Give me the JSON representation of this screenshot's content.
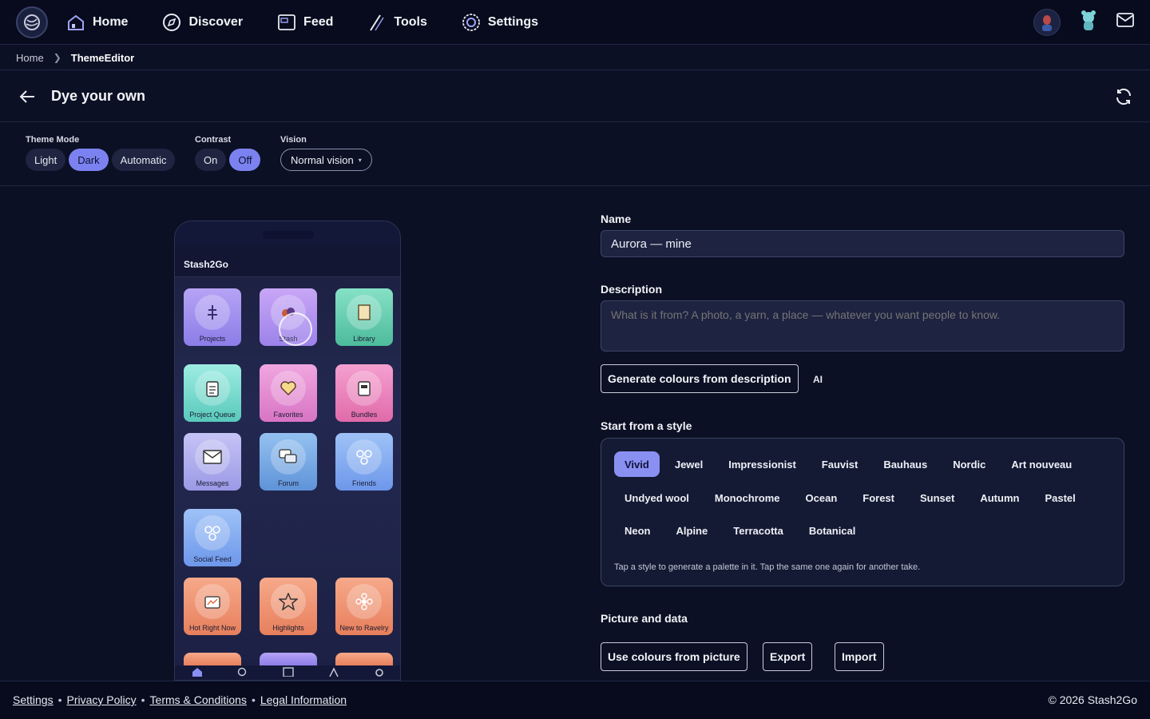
{
  "nav": {
    "items": [
      {
        "label": "Home",
        "icon": "house-icon"
      },
      {
        "label": "Discover",
        "icon": "compass-icon"
      },
      {
        "label": "Feed",
        "icon": "feed-icon"
      },
      {
        "label": "Tools",
        "icon": "wand-icon"
      },
      {
        "label": "Settings",
        "icon": "gear-icon"
      }
    ]
  },
  "breadcrumb": {
    "home": "Home",
    "current": "ThemeEditor"
  },
  "header": {
    "title": "Dye your own"
  },
  "settings": {
    "theme_mode": {
      "label": "Theme Mode",
      "options": [
        "Light",
        "Dark",
        "Automatic"
      ],
      "selected": "Dark"
    },
    "contrast": {
      "label": "Contrast",
      "options": [
        "On",
        "Off"
      ],
      "selected": "Off"
    },
    "vision": {
      "label": "Vision",
      "value": "Normal vision"
    }
  },
  "phone": {
    "app_title": "Stash2Go",
    "tiles": [
      "Projects",
      "Stash",
      "Library",
      "Project Queue",
      "Favorites",
      "Bundles",
      "Messages",
      "Forum",
      "Friends",
      "Social Feed",
      "Hot Right Now",
      "Highlights",
      "New to Ravelry"
    ]
  },
  "form": {
    "name_label": "Name",
    "name_value": "Aurora — mine",
    "description_label": "Description",
    "description_placeholder": "What is it from? A photo, a yarn, a place — whatever you want people to know.",
    "generate_button": "Generate colours from description",
    "ai_tag": "AI",
    "styles_label": "Start from a style",
    "styles_row1": [
      "Vivid",
      "Jewel",
      "Impressionist",
      "Fauvist",
      "Bauhaus",
      "Nordic",
      "Art nouveau"
    ],
    "styles_row2": [
      "Undyed wool",
      "Monochrome",
      "Ocean",
      "Forest",
      "Sunset",
      "Autumn",
      "Pastel"
    ],
    "styles_row3": [
      "Neon",
      "Alpine",
      "Terracotta",
      "Botanical"
    ],
    "styles_selected": "Vivid",
    "styles_hint": "Tap a style to generate a palette in it. Tap the same one again for another take.",
    "picture_label": "Picture and data",
    "picture_button": "Use colours from picture",
    "export_button": "Export",
    "import_button": "Import"
  },
  "footer": {
    "links": [
      "Settings",
      "Privacy Policy",
      "Terms & Conditions",
      "Legal Information"
    ],
    "copyright": "© 2026 Stash2Go"
  },
  "colors": {
    "accent": "#7b82f0",
    "background": "#0b1024",
    "nav": "#070b1d"
  }
}
